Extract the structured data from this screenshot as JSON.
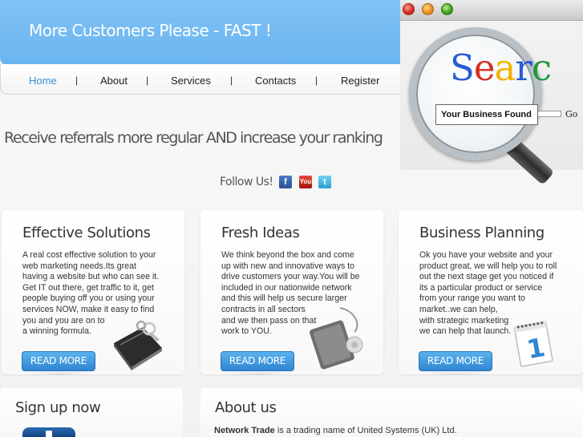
{
  "header": {
    "title": "More Customers Please - FAST !"
  },
  "nav": {
    "items": [
      {
        "label": "Home",
        "active": true
      },
      {
        "label": "About"
      },
      {
        "label": "Services"
      },
      {
        "label": "Contacts"
      },
      {
        "label": "Register"
      }
    ],
    "separator": "|"
  },
  "promo": {
    "lens_word": [
      "S",
      "e",
      "a",
      "r",
      "c"
    ],
    "search_value": "Your Business Found",
    "go_label": "Go"
  },
  "tagline": "Receive referrals more regular AND increase your ranking",
  "follow": {
    "label": "Follow Us!",
    "icons": [
      {
        "name": "facebook-icon",
        "glyph": "f"
      },
      {
        "name": "youtube-icon",
        "glyph": "You"
      },
      {
        "name": "twitter-icon",
        "glyph": "t"
      }
    ]
  },
  "panels": [
    {
      "title": "Effective Solutions",
      "body": "A real cost effective solution to your\nweb marketing needs.Its great\nhaving a website but who can see it.\nGet IT out there, get traffic to it, get\npeople buying off you or using your\nservices NOW, make it easy to find\nyou and you are on to\na winning formula.",
      "button": "READ MORE",
      "icon": "hard-drive-keys-icon"
    },
    {
      "title": "Fresh Ideas",
      "body": "We think beyond the box and come\nup with new and innovative ways to\ndrive customers your way.You will be\nincluded in our nationwide network\nand this will help us secure larger\ncontracts in all sectors\nand we then pass on that\nwork to YOU.",
      "button": "READ MORE",
      "icon": "ipod-icon"
    },
    {
      "title": "Business Planning",
      "body": "Ok you have your website and your\nproduct great, we will help you to roll\nout the next stage get you noticed if\nits a particular product or service\nfrom your range you want to\nmarket..we can help,\nwith strategic marketing\nwe can help that launch.",
      "button": "READ MORE",
      "icon": "calendar-icon",
      "calendar_number": "1"
    }
  ],
  "signup": {
    "title": "Sign up now"
  },
  "about": {
    "title": "About us",
    "brand": "Network Trade",
    "text": " is a trading name of United Systems (UK) Ltd."
  },
  "colors": {
    "banner": "#6ab4ef",
    "nav_active": "#3a8fd1",
    "button": "#2f86d1"
  }
}
